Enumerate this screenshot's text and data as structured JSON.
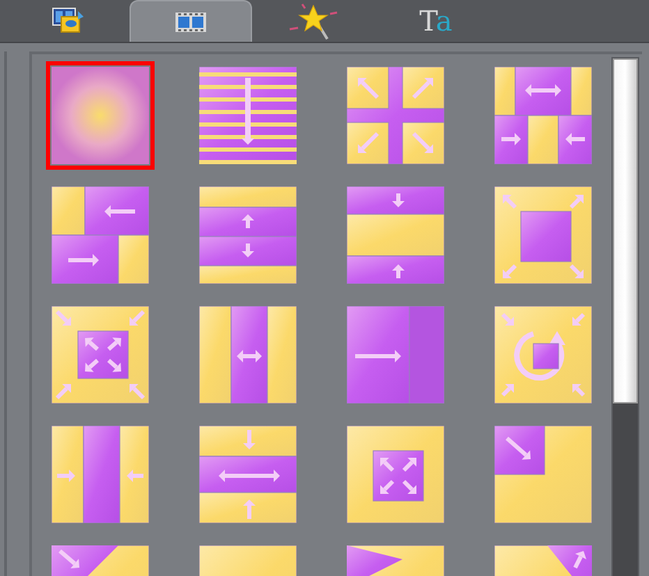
{
  "tabs": [
    {
      "kind": "media",
      "selected": false
    },
    {
      "kind": "transitions",
      "selected": true
    },
    {
      "kind": "effects",
      "selected": false
    },
    {
      "kind": "text",
      "label": "Ta",
      "selected": false
    }
  ],
  "transitions": [
    {
      "kind": "fade",
      "selected": true
    },
    {
      "kind": "blinds-down",
      "selected": false
    },
    {
      "kind": "split-corners",
      "selected": false
    },
    {
      "kind": "split-mixed",
      "selected": false
    },
    {
      "kind": "push-sides",
      "selected": false
    },
    {
      "kind": "bands-vertical",
      "selected": false
    },
    {
      "kind": "barn-close-vertical",
      "selected": false
    },
    {
      "kind": "zoom-square",
      "selected": false
    },
    {
      "kind": "zoom-in-out",
      "selected": false
    },
    {
      "kind": "barn-open-horizontal",
      "selected": false
    },
    {
      "kind": "slide-right",
      "selected": false
    },
    {
      "kind": "spin",
      "selected": false
    },
    {
      "kind": "barn-close-horizontal",
      "selected": false
    },
    {
      "kind": "bands-horizontal",
      "selected": false
    },
    {
      "kind": "zoom-center",
      "selected": false
    },
    {
      "kind": "corner-wipe",
      "selected": false
    },
    {
      "kind": "diagonal-top-left",
      "selected": false
    },
    {
      "kind": "plain-top",
      "selected": false
    },
    {
      "kind": "diagonal-bottom-left",
      "selected": false
    },
    {
      "kind": "diagonal-right",
      "selected": false
    }
  ]
}
